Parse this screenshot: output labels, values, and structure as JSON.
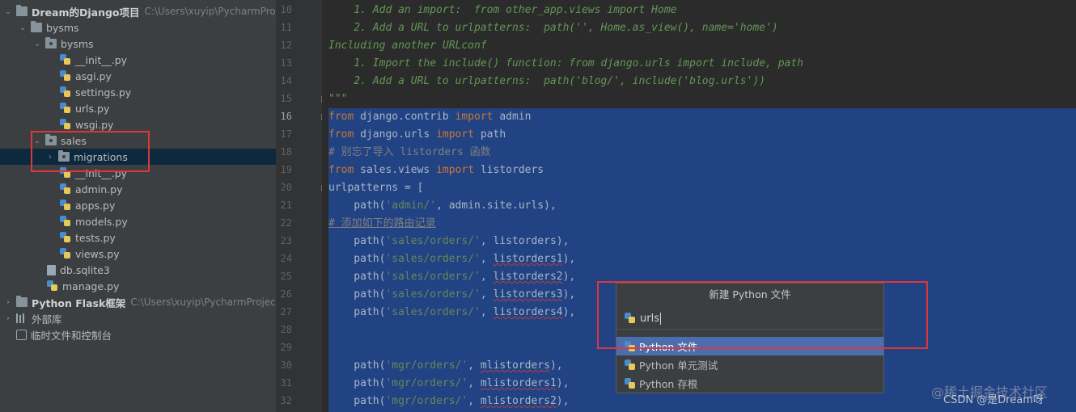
{
  "project_tree": {
    "root": {
      "label": "Dream的Django项目",
      "path": "C:\\Users\\xuyip\\PycharmProjec"
    },
    "bysms_outer": "bysms",
    "bysms_inner": "bysms",
    "bysms_files": [
      "__init__.py",
      "asgi.py",
      "settings.py",
      "urls.py",
      "wsgi.py"
    ],
    "sales": "sales",
    "migrations": "migrations",
    "sales_files": [
      "__init__.py",
      "admin.py",
      "apps.py",
      "models.py",
      "tests.py",
      "views.py"
    ],
    "db": "db.sqlite3",
    "manage": "manage.py",
    "flask": {
      "label": "Python Flask框架",
      "path": "C:\\Users\\xuyip\\PycharmProjects\\F"
    },
    "external_libs": "外部库",
    "scratches": "临时文件和控制台"
  },
  "editor": {
    "line_numbers": [
      "10",
      "11",
      "12",
      "13",
      "14",
      "15",
      "16",
      "17",
      "18",
      "19",
      "20",
      "21",
      "22",
      "23",
      "24",
      "25",
      "26",
      "27",
      "28",
      "29",
      "30",
      "31",
      "32"
    ],
    "current_line": "16",
    "doc_lines": [
      "    1. Add an import:  from other_app.views import Home",
      "    2. Add a URL to urlpatterns:  path('', Home.as_view(), name='home')",
      "Including another URLconf",
      "    1. Import the include() function: from django.urls import include, path",
      "    2. Add a URL to urlpatterns:  path('blog/', include('blog.urls'))",
      "\"\"\""
    ],
    "code": {
      "l16": {
        "kw1": "from",
        "mod": " django.contrib ",
        "kw2": "import",
        "name": " admin"
      },
      "l17": {
        "kw1": "from",
        "mod": " django.urls ",
        "kw2": "import",
        "name": " path"
      },
      "l18": "# 别忘了导入 listorders 函数",
      "l19": {
        "kw1": "from",
        "mod": " sales.views ",
        "kw2": "import",
        "name": " listorders"
      },
      "l20": "urlpatterns = [",
      "l21": {
        "pre": "    path(",
        "str": "'admin/'",
        "post": ", admin.site.urls),"
      },
      "l22": "# 添加如下的路由记录",
      "sales_paths": [
        {
          "str": "'sales/orders/'",
          "fn": "listorders"
        },
        {
          "str": "'sales/orders/'",
          "fn": "listorders1"
        },
        {
          "str": "'sales/orders/'",
          "fn": "listorders2"
        },
        {
          "str": "'sales/orders/'",
          "fn": "listorders3"
        },
        {
          "str": "'sales/orders/'",
          "fn": "listorders4"
        }
      ],
      "mgr_paths": [
        {
          "str": "'mgr/orders/'",
          "fn": "mlistorders"
        },
        {
          "str": "'mgr/orders/'",
          "fn": "mlistorders1"
        },
        {
          "str": "'mgr/orders/'",
          "fn": "mlistorders2"
        }
      ]
    }
  },
  "new_file_popup": {
    "title": "新建 Python 文件",
    "input_value": "urls",
    "options": [
      "Python 文件",
      "Python 单元测试",
      "Python 存根"
    ],
    "selected_index": 0
  },
  "watermark": {
    "line1": "@稀土掘金技术社区",
    "line2": "CSDN @是Dream呀"
  },
  "colors": {
    "annotation": "#e0353a",
    "selection": "#214283",
    "accent": "#4b6eaf"
  }
}
